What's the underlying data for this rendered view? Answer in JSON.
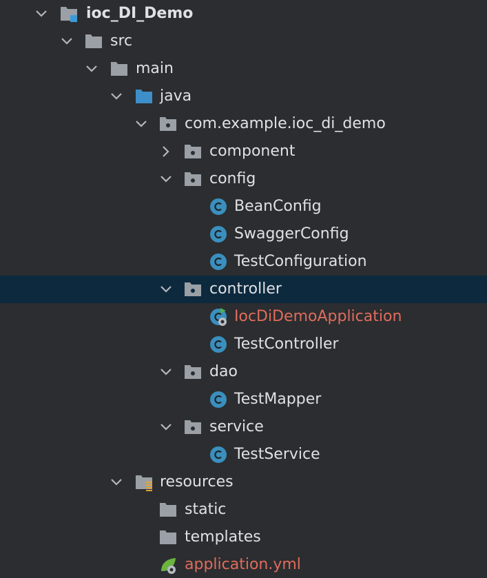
{
  "colors": {
    "background": "#2b2d30",
    "selection": "#0d293e",
    "text": "#dfe1e5",
    "folder": "#9aa0a6",
    "source_folder": "#3d8ec9",
    "class_icon": "#3a8fbe",
    "error_text": "#e06c5c",
    "spring_green": "#6db33f"
  },
  "project_tree": {
    "items": [
      {
        "label": "ioc_DI_Demo",
        "depth": 0,
        "expanded": true,
        "icon": "module-folder-icon"
      },
      {
        "label": "src",
        "depth": 1,
        "expanded": true,
        "icon": "folder-icon"
      },
      {
        "label": "main",
        "depth": 2,
        "expanded": true,
        "icon": "folder-icon"
      },
      {
        "label": "java",
        "depth": 3,
        "expanded": true,
        "icon": "source-folder-icon"
      },
      {
        "label": "com.example.ioc_di_demo",
        "depth": 4,
        "expanded": true,
        "icon": "package-icon"
      },
      {
        "label": "component",
        "depth": 5,
        "expanded": false,
        "icon": "package-icon"
      },
      {
        "label": "config",
        "depth": 5,
        "expanded": true,
        "icon": "package-icon"
      },
      {
        "label": "BeanConfig",
        "depth": 6,
        "icon": "class-icon"
      },
      {
        "label": "SwaggerConfig",
        "depth": 6,
        "icon": "class-icon"
      },
      {
        "label": "TestConfiguration",
        "depth": 6,
        "icon": "class-icon"
      },
      {
        "label": "controller",
        "depth": 5,
        "expanded": true,
        "icon": "package-icon",
        "selected": true
      },
      {
        "label": "IocDiDemoApplication",
        "depth": 6,
        "icon": "spring-boot-class-icon",
        "error": true
      },
      {
        "label": "TestController",
        "depth": 6,
        "icon": "class-icon"
      },
      {
        "label": "dao",
        "depth": 5,
        "expanded": true,
        "icon": "package-icon"
      },
      {
        "label": "TestMapper",
        "depth": 6,
        "icon": "class-icon"
      },
      {
        "label": "service",
        "depth": 5,
        "expanded": true,
        "icon": "package-icon"
      },
      {
        "label": "TestService",
        "depth": 6,
        "icon": "class-icon"
      },
      {
        "label": "resources",
        "depth": 3,
        "expanded": true,
        "icon": "resources-folder-icon"
      },
      {
        "label": "static",
        "depth": 4,
        "icon": "folder-icon"
      },
      {
        "label": "templates",
        "depth": 4,
        "icon": "folder-icon"
      },
      {
        "label": "application.yml",
        "depth": 4,
        "icon": "spring-yml-icon",
        "error": true
      }
    ]
  }
}
